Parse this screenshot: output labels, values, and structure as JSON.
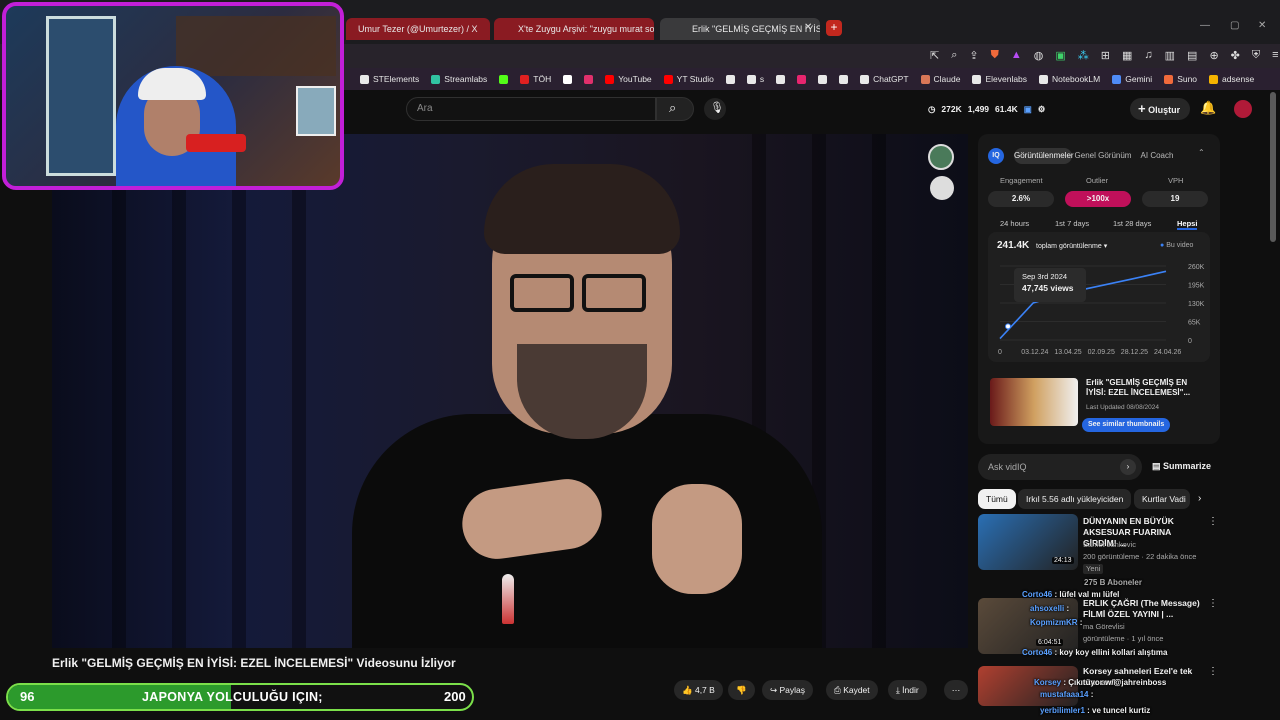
{
  "browser": {
    "tabs": [
      {
        "label": "Umur Tezer (@Umurtezer) / X",
        "color": "#8a1b22"
      },
      {
        "label": "X'te Zuygu Arşivi: \"zuygu murat sone",
        "color": "#8a1b22"
      },
      {
        "label": "Erlik \"GELMİŞ GEÇMİŞ EN İYİSİ",
        "color": "#3a3a3c"
      }
    ],
    "bookmarks": [
      {
        "label": "STElements",
        "color": "#e8e8e8"
      },
      {
        "label": "Streamlabs",
        "color": "#31c3a2"
      },
      {
        "label": "",
        "color": "#53fc18"
      },
      {
        "label": "TÖH",
        "color": "#e02020"
      },
      {
        "label": "",
        "color": "#ffffff"
      },
      {
        "label": "",
        "color": "#e1306c"
      },
      {
        "label": "YouTube",
        "color": "#ff0000"
      },
      {
        "label": "YT Studio",
        "color": "#ff0000"
      },
      {
        "label": "",
        "color": "#e8e8e8"
      },
      {
        "label": "s",
        "color": "#e8e8e8"
      },
      {
        "label": "",
        "color": "#e8e8e8"
      },
      {
        "label": "",
        "color": "#e8256f"
      },
      {
        "label": "",
        "color": "#e8e8e8"
      },
      {
        "label": "",
        "color": "#e8e8e8"
      },
      {
        "label": "ChatGPT",
        "color": "#e8e8e8"
      },
      {
        "label": "Claude",
        "color": "#d97757"
      },
      {
        "label": "Elevenlabs",
        "color": "#e8e8e8"
      },
      {
        "label": "NotebookLM",
        "color": "#e8e8e8"
      },
      {
        "label": "Gemini",
        "color": "#4f8cf7"
      },
      {
        "label": "Suno",
        "color": "#f06a3b"
      },
      {
        "label": "adsense",
        "color": "#f6b400"
      }
    ]
  },
  "youtube": {
    "search_placeholder": "Ara",
    "stats": {
      "views": "272K",
      "a": "1,499",
      "b": "61.4K"
    },
    "create_label": "Oluştur"
  },
  "video": {
    "title": "Erlik \"GELMİŞ GEÇMİŞ EN İYİSİ: EZEL İNCELEMESİ\" Videosunu İzliyor",
    "likes": "4,7 B",
    "share": "Paylaş",
    "save": "Kaydet",
    "download": "İndir"
  },
  "vidiq": {
    "tabs": [
      "Görüntülenmeler",
      "Genel Görünüm",
      "AI Coach"
    ],
    "metric_labels": [
      "Engagement",
      "Outlier",
      "VPH"
    ],
    "metric_values": [
      "2.6%",
      ">100x",
      "19"
    ],
    "ranges": [
      "24 hours",
      "1st 7 days",
      "1st 28 days",
      "Hepsi"
    ],
    "total": "241.4K",
    "total_label": "toplam görüntülenme",
    "legend": "Bu video",
    "tooltip_date": "Sep 3rd 2024",
    "tooltip_value": "47,745 views",
    "y_ticks": [
      "260K",
      "195K",
      "130K",
      "65K",
      "0"
    ],
    "x_ticks": [
      "0",
      "03.12.24",
      "13.04.25",
      "02.09.25",
      "28.12.25",
      "24.04.26"
    ],
    "card_title": "Erlik \"GELMİŞ GEÇMİŞ EN İYİSİ: EZEL İNCELEMESİ\"...",
    "card_sub": "Last Updated 08/08/2024",
    "card_btn": "See similar thumbnails",
    "ask_placeholder": "Ask vidIQ",
    "summarize": "Summarize"
  },
  "chart_data": {
    "type": "line",
    "x": [
      "0",
      "03.12.24",
      "13.04.25",
      "02.09.25",
      "28.12.25",
      "24.04.26"
    ],
    "series": [
      {
        "name": "Bu video",
        "values": [
          5000,
          130000,
          165000,
          190000,
          215000,
          241400
        ]
      }
    ],
    "ylim": [
      0,
      260000
    ],
    "tooltip": {
      "date": "Sep 3rd 2024",
      "value": 47745
    }
  },
  "filters": [
    "Tümü",
    "Irkıl 5.56 adlı yükleyiciden",
    "Kurtlar Vadi"
  ],
  "recs": [
    {
      "title": "DÜNYANIN EN BÜYÜK AKSESUAR FUARINA GİRDİM! ...",
      "channel": "Samet Jankovic",
      "meta": "200 görüntüleme · 22 dakika önce",
      "badge": "Yeni",
      "duration": "24:13",
      "thumb": "#2a6fb4"
    },
    {
      "title": "ERLIK ÇAĞRI (The Message) FİLMİ ÖZEL YAYINI | ...",
      "channel": "ma Görevlisi",
      "meta": "görüntüleme · 1 yıl önce",
      "badge": "",
      "duration": "6:04:51",
      "thumb": "#5a4a3a"
    },
    {
      "title": "Korsey sahneleri Ezel'e tek atar amk",
      "channel": "",
      "meta": "",
      "badge": "",
      "duration": "",
      "thumb": "#b04030"
    }
  ],
  "chat": [
    {
      "user": "Corto46",
      "text": ": lüfel val mı lüfel"
    },
    {
      "user": "ahsoxelli",
      "text": ":"
    },
    {
      "user": "KopmizmKR",
      "text": ":"
    },
    {
      "user": "Corto46",
      "text": ": koy koy ellini kollari alıştıma"
    },
    {
      "user": "Korsey",
      "text": ": Çıkıtüyor w/@jahreinboss"
    },
    {
      "user": "mustafaaa14",
      "text": ":"
    },
    {
      "user": "yerbilimler1",
      "text": ": ve tuncel kurtiz"
    }
  ],
  "chat_badge": "275 B Aboneler",
  "goal": {
    "current": "96",
    "label": "JAPONYA YOLCULUĞU IÇIN;",
    "target": "200",
    "progress": 0.48
  }
}
